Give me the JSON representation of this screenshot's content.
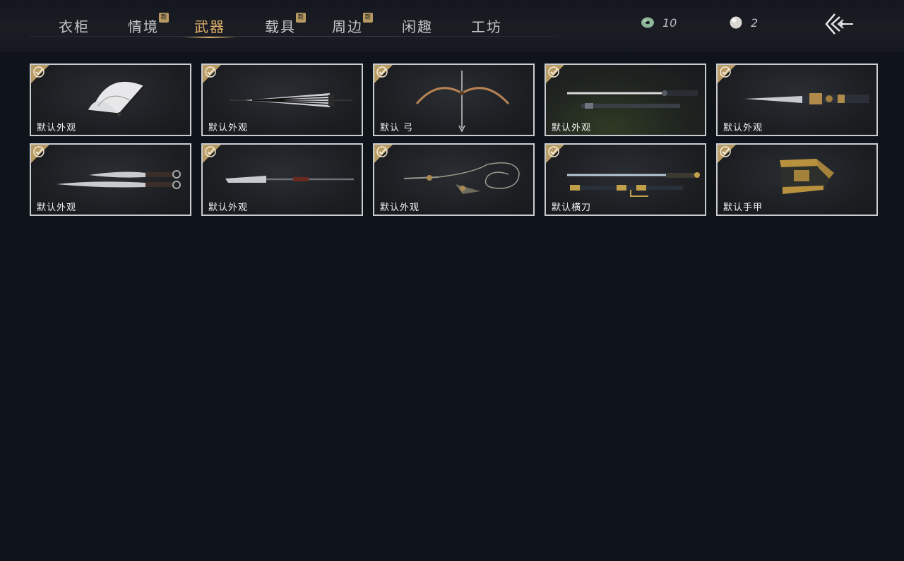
{
  "tabs": [
    {
      "label": "衣柜",
      "badge": ""
    },
    {
      "label": "情境",
      "badge": "新"
    },
    {
      "label": "武器",
      "badge": ""
    },
    {
      "label": "载具",
      "badge": "新"
    },
    {
      "label": "周边",
      "badge": "新"
    },
    {
      "label": "闲趣",
      "badge": ""
    },
    {
      "label": "工坊",
      "badge": ""
    }
  ],
  "active_tab": "武器",
  "currency": {
    "jade": {
      "icon": "jade-coin-icon",
      "value": "10"
    },
    "pearl": {
      "icon": "pearl-icon",
      "value": "2"
    }
  },
  "back_icon": "back-arrow-icon",
  "colors": {
    "accent": "#e0b06a",
    "badge": "#b89a63",
    "background": "#0f131a",
    "card_border": "#c9ccd1"
  },
  "items": [
    {
      "label": "默认外观",
      "icon": "fan-icon",
      "selected": true
    },
    {
      "label": "默认外观",
      "icon": "umbrella-icon",
      "selected": true
    },
    {
      "label": "默认 弓",
      "icon": "bow-icon",
      "selected": true
    },
    {
      "label": "默认外观",
      "icon": "sword-scabbard-icon",
      "selected": true
    },
    {
      "label": "默认外观",
      "icon": "ornate-blade-icon",
      "selected": true
    },
    {
      "label": "默认外观",
      "icon": "twin-blades-icon",
      "selected": true
    },
    {
      "label": "默认外观",
      "icon": "spear-icon",
      "selected": true
    },
    {
      "label": "默认外观",
      "icon": "rope-dart-icon",
      "selected": true
    },
    {
      "label": "默认横刀",
      "icon": "hengdao-icon",
      "selected": true
    },
    {
      "label": "默认手甲",
      "icon": "gauntlet-icon",
      "selected": true
    }
  ]
}
